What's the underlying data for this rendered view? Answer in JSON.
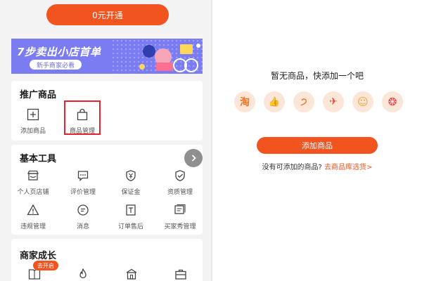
{
  "left": {
    "open_button": "0元开通",
    "banner": {
      "title": "7步卖出小店首单",
      "pill": "新手商家必看"
    },
    "promo": {
      "title": "推广商品",
      "items": [
        {
          "label": "添加商品",
          "icon": "plus-square-icon"
        },
        {
          "label": "商品管理",
          "icon": "shopping-bag-icon"
        }
      ]
    },
    "basic_tools": {
      "title": "基本工具",
      "items": [
        {
          "label": "个人页店铺",
          "icon": "storefront-icon"
        },
        {
          "label": "评价管理",
          "icon": "comment-icon"
        },
        {
          "label": "保证金",
          "icon": "deposit-shield-icon"
        },
        {
          "label": "资质管理",
          "icon": "qualification-shield-icon"
        },
        {
          "label": "违规管理",
          "icon": "warning-icon"
        },
        {
          "label": "消息",
          "icon": "message-icon"
        },
        {
          "label": "订单售后",
          "icon": "order-icon"
        },
        {
          "label": "买家秀管理",
          "icon": "gallery-icon"
        }
      ]
    },
    "growth": {
      "title": "商家成长",
      "badge": "去开启"
    }
  },
  "right": {
    "empty_text": "暂无商品，快添加一个吧",
    "source_icons": [
      {
        "name": "taobao-icon",
        "glyph": "淘",
        "color": "#f0772a"
      },
      {
        "name": "thumbs-up-icon",
        "glyph": "👍",
        "color": "#f26a2a"
      },
      {
        "name": "swirl-icon",
        "glyph": "੭",
        "color": "#f0772a"
      },
      {
        "name": "bird-icon",
        "glyph": "✈",
        "color": "#e84a3c"
      },
      {
        "name": "face-icon",
        "glyph": "☺",
        "color": "#f3a03a"
      },
      {
        "name": "pattern-icon",
        "glyph": "❂",
        "color": "#e8404c"
      }
    ],
    "add_button": "添加商品",
    "hint_prefix": "没有可添加的商品?",
    "hint_link": "去商品库选货>"
  },
  "colors": {
    "accent": "#f2541f",
    "highlight": "#e4232c",
    "banner": "#7b7cf2"
  }
}
